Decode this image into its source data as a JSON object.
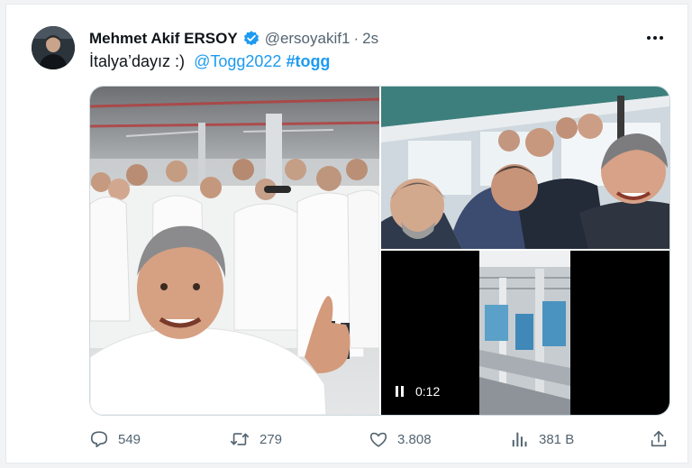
{
  "tweet": {
    "author_name": "Mehmet Akif ERSOY",
    "handle": "@ersoyakif1",
    "separator": "·",
    "time": "2s",
    "text_prefix": "İtalya’dayız :)",
    "mention": "@Togg2022",
    "hashtag": "#togg"
  },
  "video": {
    "timestamp": "0:12"
  },
  "actions": {
    "replies": "549",
    "retweets": "279",
    "likes": "3.808",
    "views": "381 B"
  },
  "colors": {
    "accent": "#1d9bf0",
    "text": "#0f1419",
    "secondary": "#536471"
  },
  "icons": [
    "verified-badge-icon",
    "more-icon",
    "pause-icon",
    "reply-icon",
    "retweet-icon",
    "like-icon",
    "views-icon",
    "share-icon"
  ]
}
